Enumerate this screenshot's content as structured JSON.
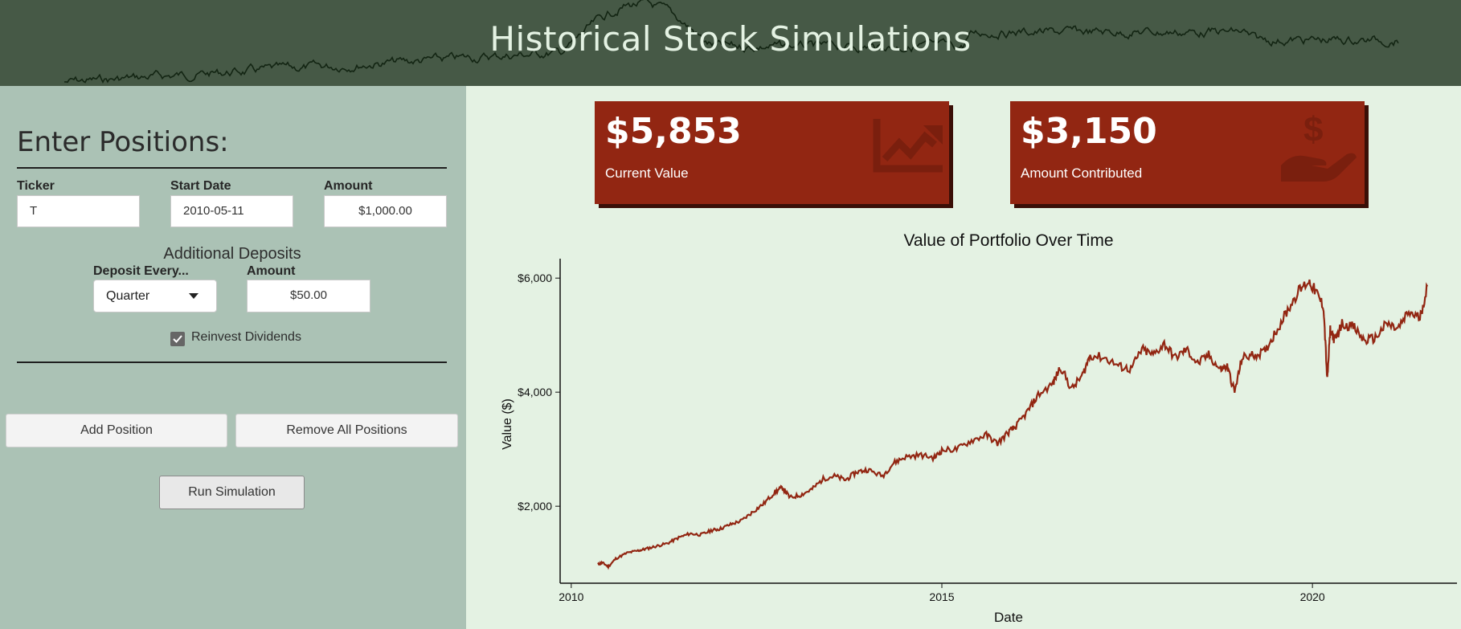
{
  "header": {
    "title": "Historical Stock Simulations"
  },
  "sidebar": {
    "section_title": "Enter Positions:",
    "ticker": {
      "label": "Ticker",
      "value": "T"
    },
    "start_date": {
      "label": "Start Date",
      "value": "2010-05-11"
    },
    "amount": {
      "label": "Amount",
      "value": "$1,000.00"
    },
    "additional_deposits": {
      "title": "Additional Deposits",
      "frequency": {
        "label": "Deposit Every...",
        "selected": "Quarter"
      },
      "amount": {
        "label": "Amount",
        "value": "$50.00"
      }
    },
    "reinvest": {
      "label": "Reinvest Dividends",
      "checked": true
    },
    "buttons": {
      "add": "Add Position",
      "remove_all": "Remove All Positions",
      "run": "Run Simulation"
    }
  },
  "value_boxes": {
    "current": {
      "value": "$5,853",
      "label": "Current Value",
      "icon": "chart-line-icon"
    },
    "contributed": {
      "value": "$3,150",
      "label": "Amount Contributed",
      "icon": "hand-holding-dollar-icon"
    }
  },
  "colors": {
    "header": "#465946",
    "sidebar": "#abc2b5",
    "main": "#e4f2e3",
    "accent": "#922612"
  },
  "chart_data": {
    "type": "line",
    "title": "Value of Portfolio Over Time",
    "xlabel": "Date",
    "ylabel": "Value ($)",
    "x_ticks": [
      "2010",
      "2015",
      "2020"
    ],
    "y_ticks": [
      "$2,000",
      "$4,000",
      "$6,000"
    ],
    "xlim": [
      2009.85,
      2021.95
    ],
    "ylim": [
      650,
      6200
    ],
    "grid": false,
    "series": [
      {
        "color": "#922612",
        "x": [
          2010.36,
          2010.42,
          2010.5,
          2010.6,
          2010.75,
          2010.9,
          2011.0,
          2011.15,
          2011.3,
          2011.45,
          2011.6,
          2011.75,
          2011.9,
          2012.0,
          2012.15,
          2012.3,
          2012.45,
          2012.6,
          2012.75,
          2012.85,
          2012.95,
          2013.1,
          2013.25,
          2013.4,
          2013.55,
          2013.7,
          2013.85,
          2014.0,
          2014.2,
          2014.35,
          2014.5,
          2014.7,
          2014.9,
          2015.0,
          2015.2,
          2015.4,
          2015.6,
          2015.75,
          2015.9,
          2016.0,
          2016.15,
          2016.3,
          2016.5,
          2016.6,
          2016.75,
          2016.9,
          2017.0,
          2017.2,
          2017.4,
          2017.55,
          2017.7,
          2017.85,
          2018.0,
          2018.15,
          2018.3,
          2018.45,
          2018.6,
          2018.75,
          2018.85,
          2018.95,
          2019.05,
          2019.2,
          2019.35,
          2019.5,
          2019.65,
          2019.8,
          2019.95,
          2020.05,
          2020.15,
          2020.2,
          2020.24,
          2020.3,
          2020.4,
          2020.55,
          2020.7,
          2020.85,
          2021.0,
          2021.15,
          2021.3,
          2021.45,
          2021.55
        ],
        "y": [
          980,
          1010,
          940,
          1080,
          1180,
          1220,
          1250,
          1300,
          1350,
          1450,
          1520,
          1500,
          1580,
          1600,
          1680,
          1750,
          1900,
          2050,
          2250,
          2330,
          2150,
          2200,
          2300,
          2480,
          2530,
          2460,
          2600,
          2640,
          2530,
          2760,
          2860,
          2900,
          2850,
          2980,
          3000,
          3150,
          3250,
          3100,
          3300,
          3400,
          3650,
          3950,
          4150,
          4450,
          4050,
          4300,
          4650,
          4600,
          4450,
          4400,
          4750,
          4650,
          4850,
          4600,
          4750,
          4500,
          4650,
          4400,
          4450,
          4000,
          4600,
          4650,
          4700,
          5050,
          5400,
          5750,
          5950,
          5750,
          5500,
          4200,
          5100,
          4900,
          5200,
          5150,
          4900,
          4950,
          5200,
          5100,
          5400,
          5300,
          5853
        ]
      }
    ]
  }
}
